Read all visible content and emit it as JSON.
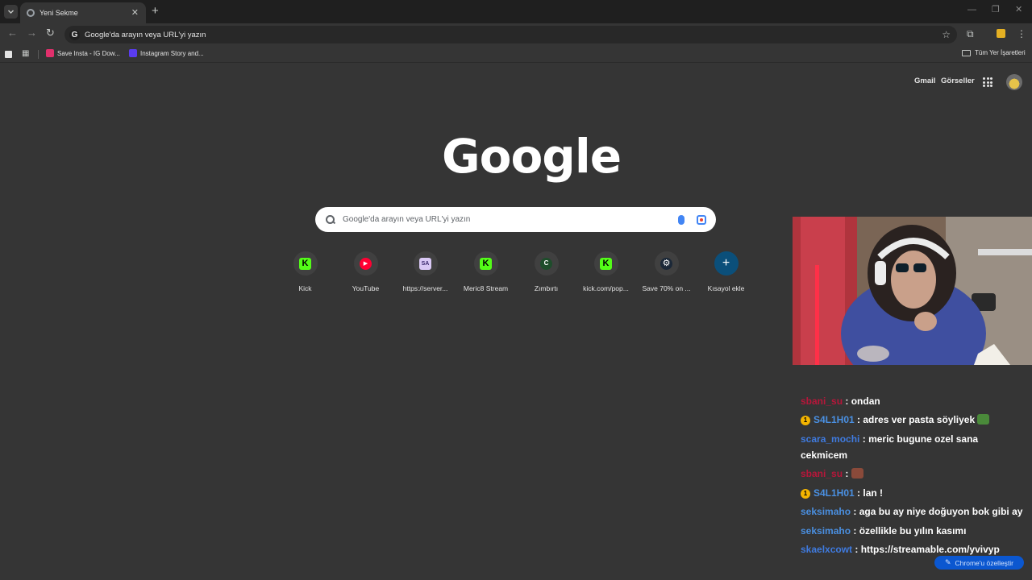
{
  "tabbar": {
    "tab_title": "Yeni Sekme",
    "new_tab": "+"
  },
  "toolbar": {
    "omnibox_text": "Google'da arayın veya URL'yi yazın"
  },
  "bookmarks": {
    "items": [
      {
        "label": "Save Insta - IG Dow...",
        "color": "#e1306c"
      },
      {
        "label": "Instagram Story and...",
        "color": "#5a3cf0"
      }
    ],
    "all_bookmarks": "Tüm Yer İşaretleri"
  },
  "header": {
    "gmail": "Gmail",
    "images": "Görseller"
  },
  "logo": "Google",
  "search": {
    "placeholder": "Google'da arayın veya URL'yi yazın"
  },
  "shortcuts": [
    {
      "label": "Kick",
      "glyph": "K",
      "bg": "#53fc18",
      "fg": "#000000"
    },
    {
      "label": "YouTube",
      "glyph": "▶",
      "bg": "#ff0033",
      "fg": "#ffffff"
    },
    {
      "label": "https://server...",
      "glyph": "SA",
      "bg": "#d9c8f5",
      "fg": "#3b2a6e"
    },
    {
      "label": "Meric8 Stream",
      "glyph": "K",
      "bg": "#53fc18",
      "fg": "#000000"
    },
    {
      "label": "Zımbırtı",
      "glyph": "C",
      "bg": "#1e4d2b",
      "fg": "#ffffff"
    },
    {
      "label": "kick.com/pop...",
      "glyph": "K",
      "bg": "#53fc18",
      "fg": "#000000"
    },
    {
      "label": "Save 70% on ...",
      "glyph": "⚙",
      "bg": "#1b2838",
      "fg": "#ffffff"
    },
    {
      "label": "Kısayol ekle",
      "glyph": "+",
      "bg": "#0b4f7a",
      "fg": "#ffffff"
    }
  ],
  "chat": [
    {
      "user": "sbani_su",
      "color": "#b8163a",
      "badge": false,
      "text": ": ondan"
    },
    {
      "user": "S4L1H01",
      "color": "#4a90e2",
      "badge": true,
      "text": ": adres ver pasta söyliyek"
    },
    {
      "user": "scara_mochi",
      "color": "#3f7be0",
      "badge": false,
      "text": ": meric bugune ozel sana cekmicem"
    },
    {
      "user": "sbani_su",
      "color": "#b8163a",
      "badge": false,
      "text": ":"
    },
    {
      "user": "S4L1H01",
      "color": "#4a90e2",
      "badge": true,
      "text": ": lan !"
    },
    {
      "user": "seksimaho",
      "color": "#4a8fe0",
      "badge": false,
      "text": ": aga bu ay niye doğuyon bok gibi ay"
    },
    {
      "user": "seksimaho",
      "color": "#4a8fe0",
      "badge": false,
      "text": ": özellikle bu yılın kasımı"
    },
    {
      "user": "skaelxcowt",
      "color": "#3f7be0",
      "badge": false,
      "text": ": https://streamable.com/yvivyp"
    }
  ],
  "customize": "Chrome'u özelleştir"
}
